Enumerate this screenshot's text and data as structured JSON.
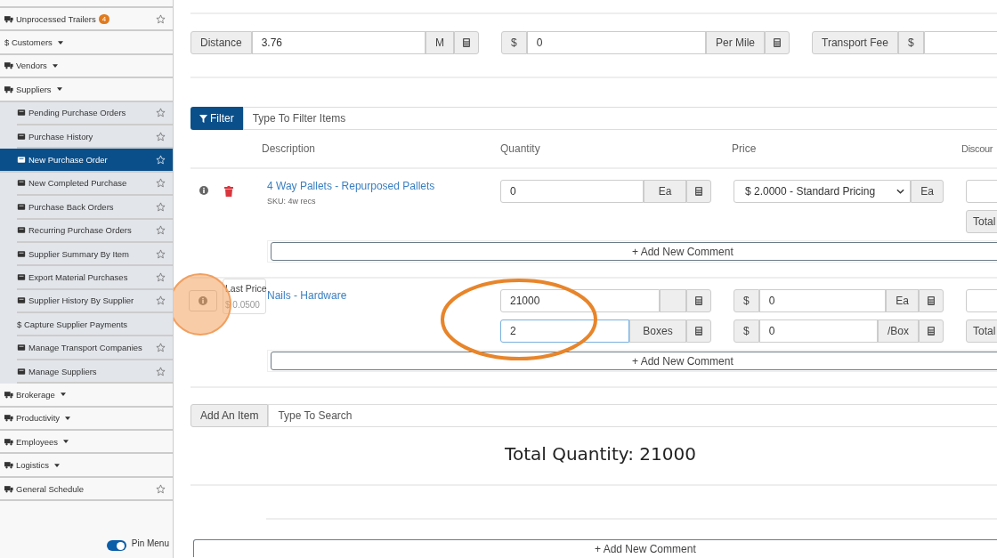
{
  "sidebar": {
    "items": [
      {
        "label": "Unprocessed Trailers",
        "badge": "4",
        "favorite": false,
        "selected": false
      },
      {
        "label": "$ Customers",
        "has_menu": true,
        "selected": false
      },
      {
        "label": "Vendors",
        "has_menu": true,
        "selected": false
      },
      {
        "label": "Suppliers",
        "has_menu": true,
        "selected": false,
        "children": [
          {
            "label": "Pending Purchase Orders",
            "favorite": false,
            "selected": false
          },
          {
            "label": "Purchase History",
            "favorite": false,
            "selected": false
          },
          {
            "label": "New Purchase Order",
            "favorite": false,
            "selected": true
          },
          {
            "label": "New Completed Purchase",
            "favorite": false,
            "selected": false
          },
          {
            "label": "Purchase Back Orders",
            "favorite": false,
            "selected": false
          },
          {
            "label": "Recurring Purchase Orders",
            "favorite": false,
            "selected": false
          },
          {
            "label": "Supplier Summary By Item",
            "favorite": false,
            "selected": false
          },
          {
            "label": "Export Material Purchases",
            "favorite": false,
            "selected": false
          },
          {
            "label": "Supplier History By Supplier",
            "favorite": false,
            "selected": false
          },
          {
            "label": "$ Capture Supplier Payments",
            "selected": false
          },
          {
            "label": "Manage Transport Companies",
            "favorite": false,
            "selected": false
          },
          {
            "label": "Manage Suppliers",
            "favorite": false,
            "selected": false
          }
        ]
      },
      {
        "label": "Brokerage",
        "has_menu": true,
        "selected": false
      },
      {
        "label": "Productivity",
        "has_menu": true,
        "selected": false
      },
      {
        "label": "Employees",
        "has_menu": true,
        "selected": false
      },
      {
        "label": "Logistics",
        "has_menu": true,
        "selected": false
      },
      {
        "label": "General Schedule",
        "favorite": false,
        "selected": false
      }
    ],
    "pin_menu": {
      "label": "Pin Menu",
      "on": true
    }
  },
  "transport": [
    {
      "label": "Distance",
      "value": "3.76",
      "unit": "M",
      "calculator": true
    },
    {
      "prefix": "$",
      "value": "0",
      "unit": "Per Mile",
      "calculator": true
    },
    {
      "label": "Transport Fee",
      "prefix": "$"
    }
  ],
  "filter": {
    "button": "Filter",
    "placeholder": "Type To Filter Items"
  },
  "columns": [
    "Description",
    "Quantity",
    "Price",
    "Discour"
  ],
  "items": [
    {
      "description": "4 Way Pallets - Repurposed Pallets",
      "sku": "SKU: 4w recs",
      "quantity_rows": [
        {
          "value": "0",
          "unit": "Ea",
          "focused": false
        }
      ],
      "price_rows": [
        {
          "kind": "select",
          "value": "$ 2.0000 - Standard Pricing",
          "unit": "Ea"
        }
      ],
      "total_button": "Total",
      "comment_button": "+ Add New Comment"
    },
    {
      "description": "Nails - Hardware",
      "tooltip": {
        "title": "Last Price",
        "value": "$ 0.0500"
      },
      "quantity_rows": [
        {
          "value": "21000",
          "focused": false
        },
        {
          "value": "2",
          "unit": "Boxes",
          "focused": true
        }
      ],
      "price_rows": [
        {
          "kind": "input",
          "prefix": "$",
          "value": "0",
          "unit": "Ea",
          "calculator": true
        },
        {
          "kind": "input",
          "prefix": "$",
          "value": "0",
          "unit": "/Box",
          "calculator": true
        }
      ],
      "total_button": "Total",
      "comment_button": "+ Add New Comment"
    }
  ],
  "add_item": {
    "label": "Add An Item",
    "placeholder": "Type To Search"
  },
  "total_quantity": "Total Quantity: 21000",
  "footer_comment": "+ Add New Comment"
}
